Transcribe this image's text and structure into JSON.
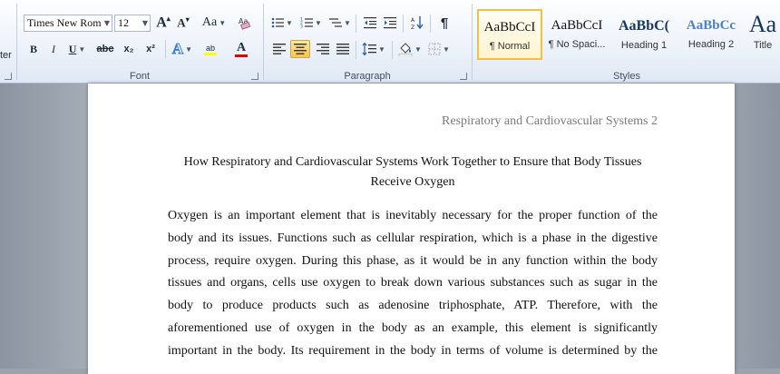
{
  "ribbon": {
    "clipboard": {
      "label_partial": "ter"
    },
    "font": {
      "label": "Font",
      "font_name": "Times New Rom",
      "font_size": "12",
      "grow_icon": "font-grow-icon",
      "shrink_icon": "font-shrink-icon",
      "change_case_label": "Aa",
      "clear_format_icon": "clear-formatting-icon",
      "bold": "B",
      "italic": "I",
      "underline": "U",
      "strike": "abc",
      "subscript": "x₂",
      "superscript": "x²",
      "highlight_label": "ab",
      "font_color_label": "A",
      "highlight_color": "#ffff00",
      "font_color": "#e00000"
    },
    "paragraph": {
      "label": "Paragraph",
      "pilcrow": "¶"
    },
    "styles": {
      "label": "Styles",
      "items": [
        {
          "preview": "AaBbCcI",
          "name": "¶ Normal",
          "selected": true
        },
        {
          "preview": "AaBbCcI",
          "name": "¶ No Spaci..."
        },
        {
          "preview": "AaBbC(",
          "name": "Heading 1"
        },
        {
          "preview": "AaBbCc",
          "name": "Heading 2"
        },
        {
          "preview": "Aa",
          "name": "Title"
        }
      ]
    }
  },
  "document": {
    "header": "Respiratory and Cardiovascular  Systems  2",
    "title_line1": "How Respiratory and Cardiovascular  Systems Work Together to Ensure that Body Tissues",
    "title_line2": "Receive  Oxygen",
    "body_lines": [
      "Oxygen is an important element that is inevitably necessary for the proper function of the",
      "body and its issues. Functions such as cellular respiration, which is a phase in the digestive",
      "process, require oxygen. During this phase, as it would be in any function within the body",
      "tissues and organs, cells use oxygen to break down various substances such as sugar in the",
      "body to produce products such as adenosine triphosphate, ATP. Therefore, with the",
      "aforementioned use of oxygen in the body as an example, this element is significantly",
      "important in the body. Its requirement in the body in terms of volume is determined by the"
    ]
  }
}
